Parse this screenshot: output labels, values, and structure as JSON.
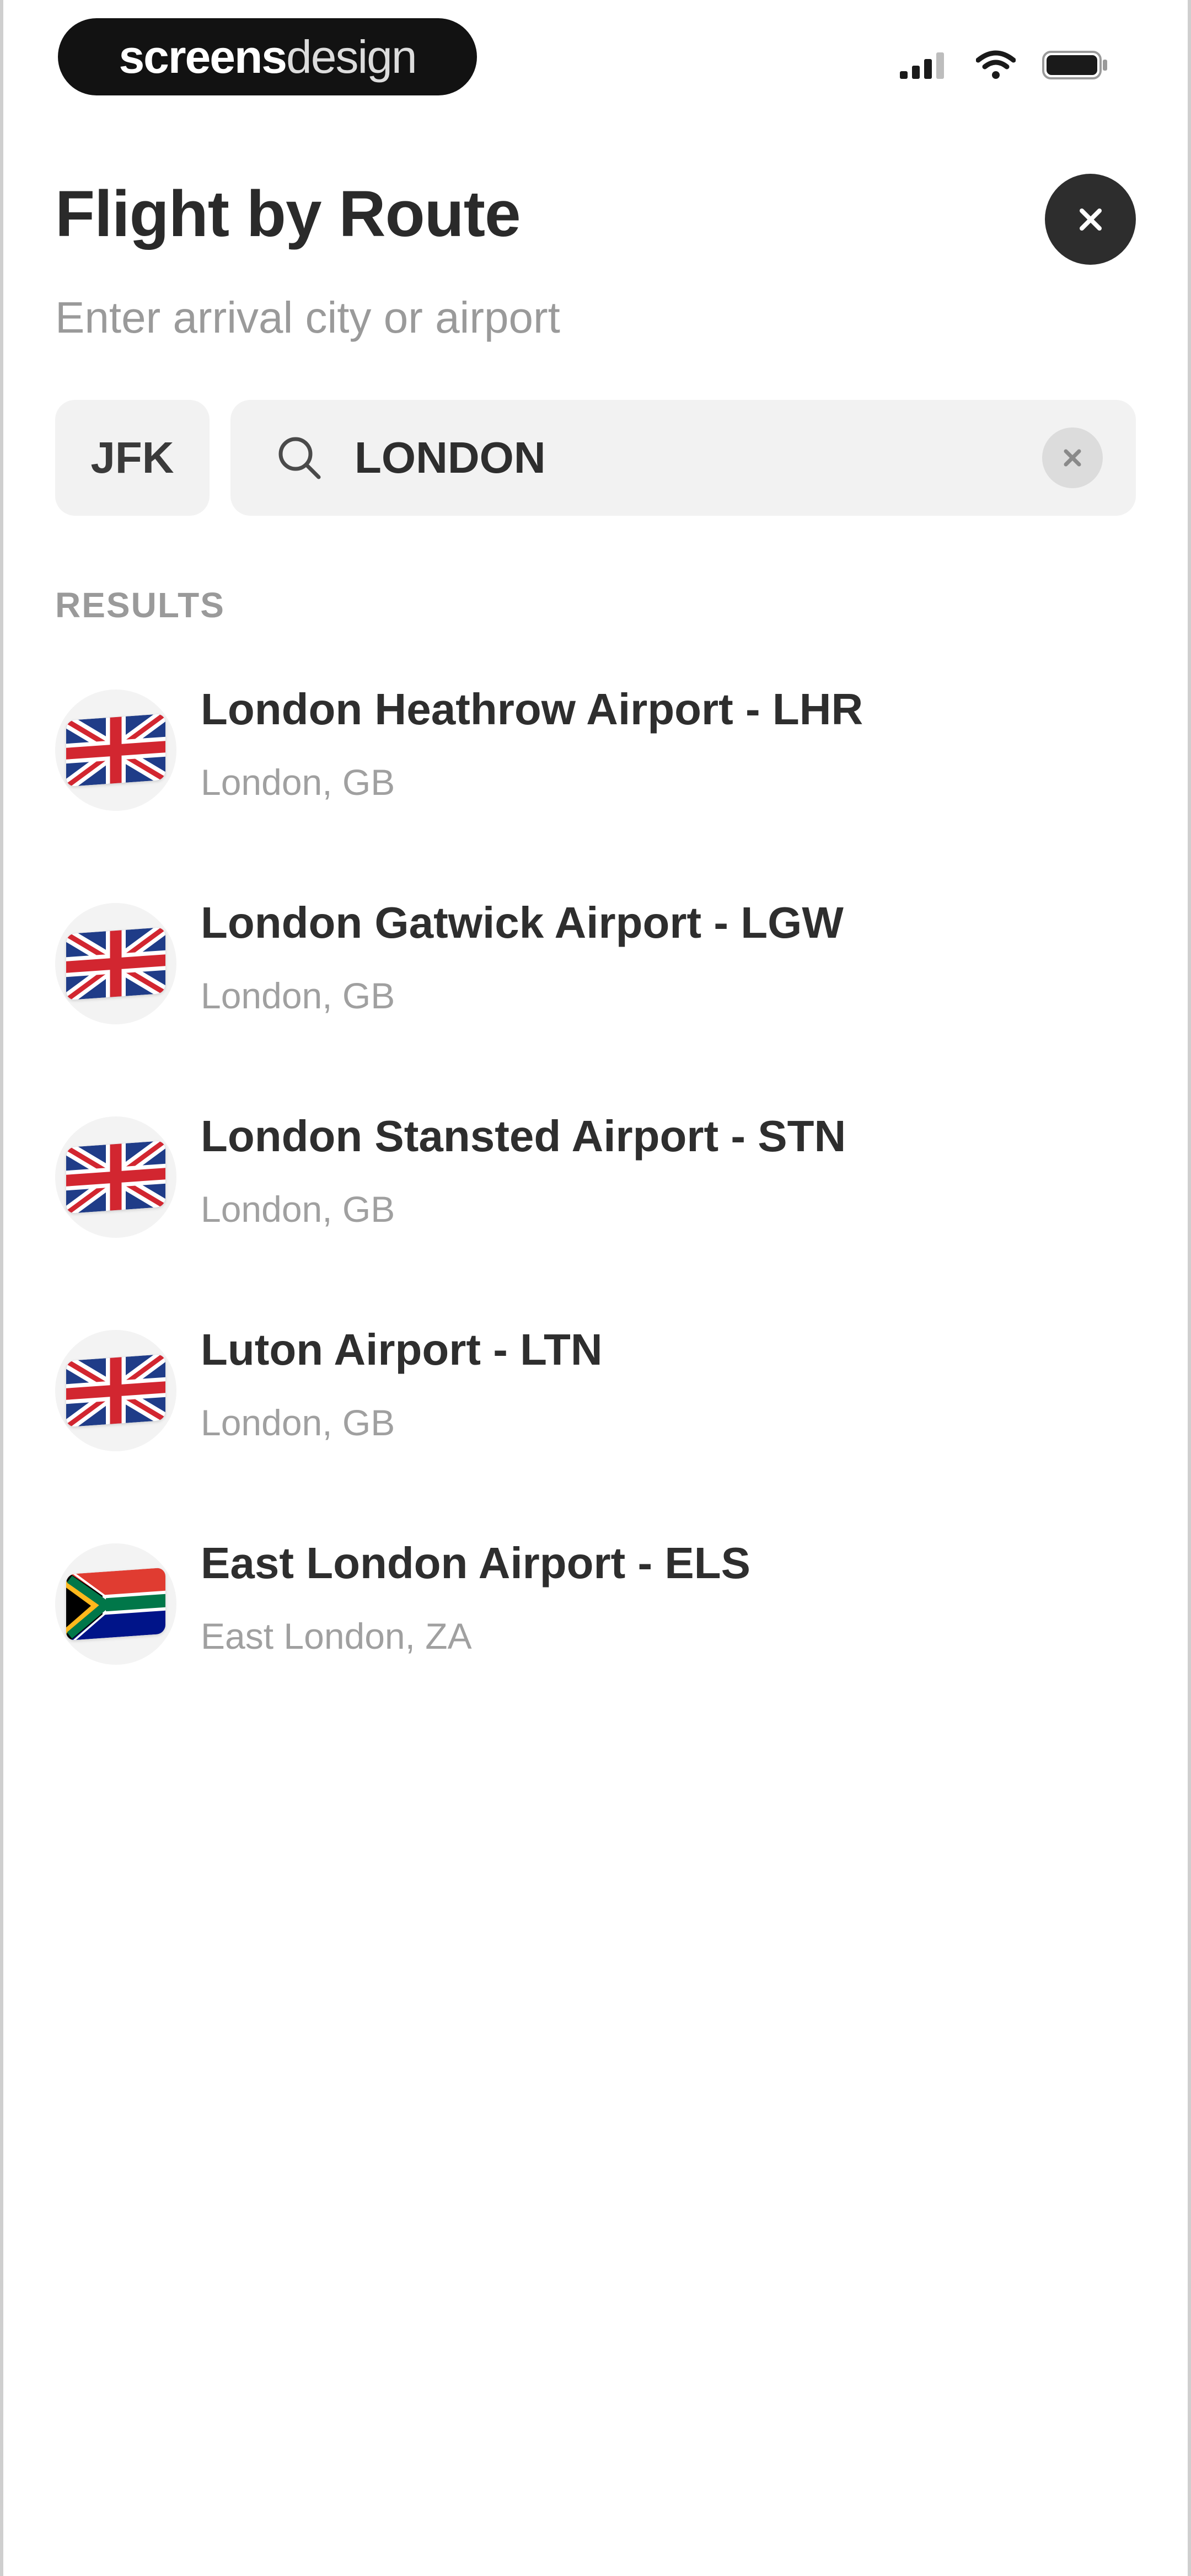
{
  "status_bar": {
    "brand_bold": "screens",
    "brand_light": "design",
    "icons": [
      "signal-icon",
      "wifi-icon",
      "battery-icon"
    ]
  },
  "header": {
    "title": "Flight by Route",
    "subtitle": "Enter arrival city or airport",
    "close_icon": "close-icon"
  },
  "search": {
    "origin": "JFK",
    "value": "LONDON",
    "placeholder": "",
    "search_icon": "search-icon",
    "clear_icon": "clear-icon"
  },
  "results": {
    "label": "RESULTS",
    "items": [
      {
        "name": "London Heathrow Airport - LHR",
        "location": "London, GB",
        "flag": "gb-flag-icon"
      },
      {
        "name": "London Gatwick Airport - LGW",
        "location": "London, GB",
        "flag": "gb-flag-icon"
      },
      {
        "name": "London Stansted Airport - STN",
        "location": "London, GB",
        "flag": "gb-flag-icon"
      },
      {
        "name": "Luton Airport - LTN",
        "location": "London, GB",
        "flag": "gb-flag-icon"
      },
      {
        "name": "East London Airport - ELS",
        "location": "East London, ZA",
        "flag": "za-flag-icon"
      }
    ]
  },
  "colors": {
    "text_primary": "#2e2e2e",
    "text_secondary": "#9a9a9a",
    "field_bg": "#f2f2f2",
    "close_button_bg": "#2d2d2d"
  }
}
